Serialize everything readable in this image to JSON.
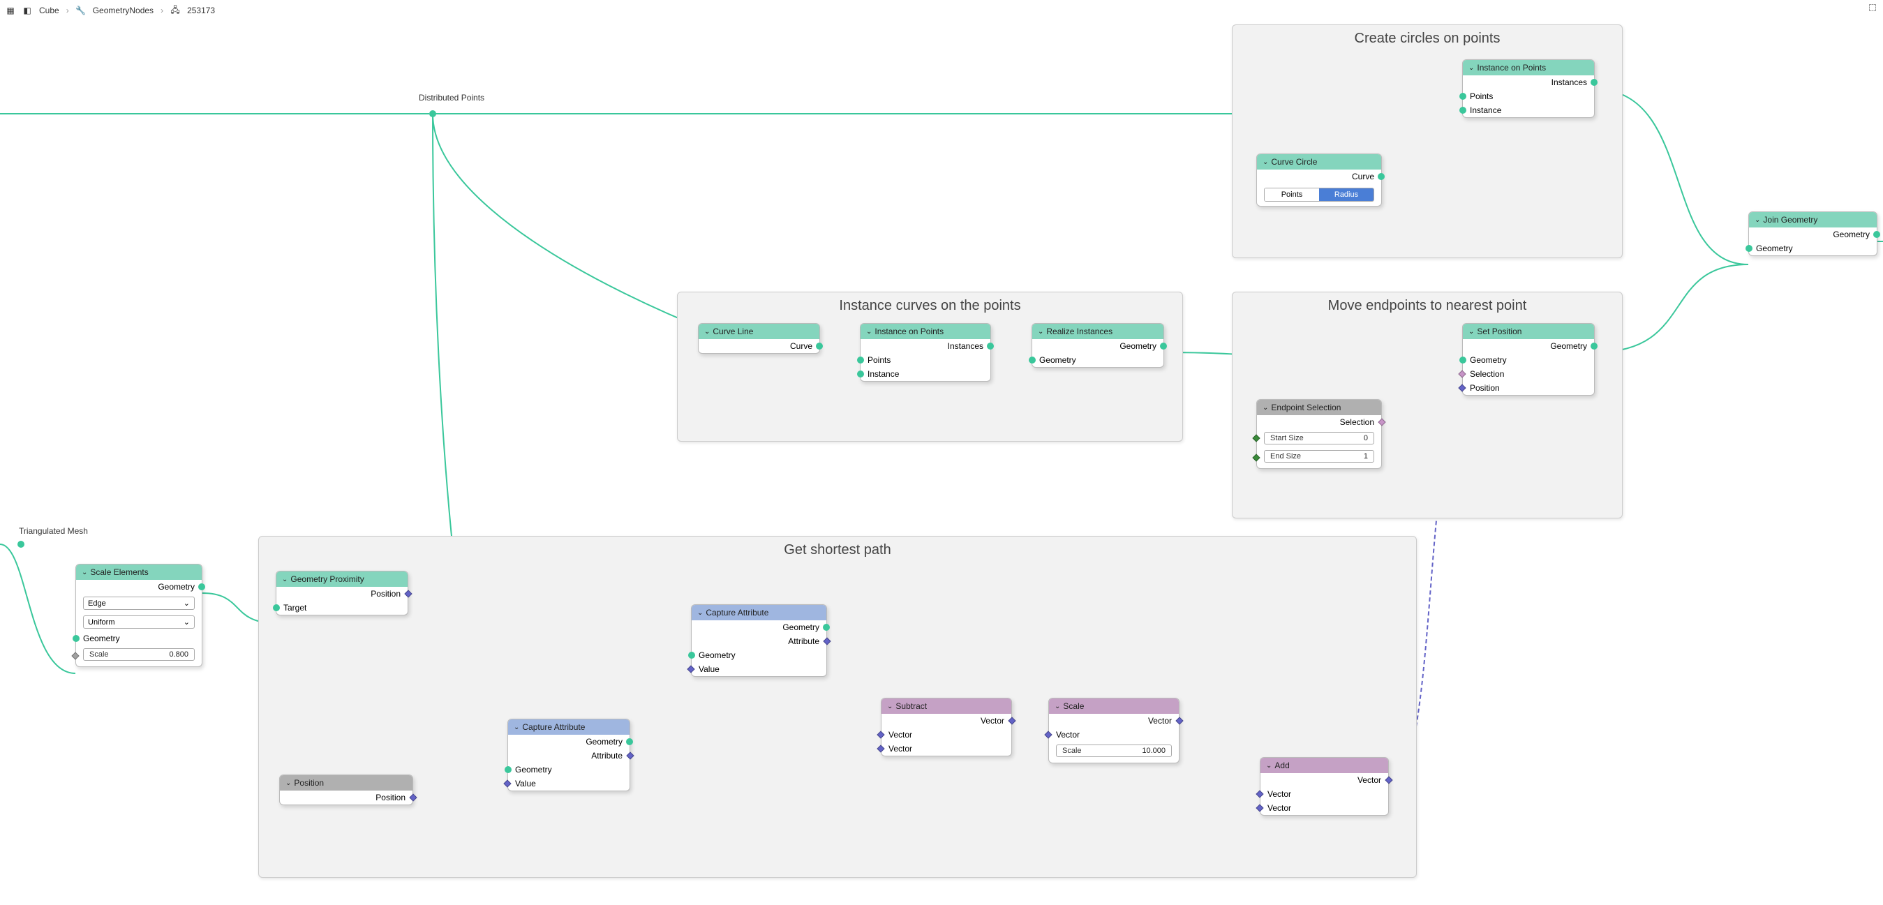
{
  "breadcrumb": {
    "cube": "Cube",
    "gn": "GeometryNodes",
    "num": "253173"
  },
  "labels": {
    "distributed_points": "Distributed Points",
    "triangulated_mesh": "Triangulated Mesh"
  },
  "frames": {
    "circles": "Create circles on points",
    "instance_curves": "Instance curves on the points",
    "move_endpoints": "Move endpoints to nearest point",
    "shortest_path": "Get shortest path"
  },
  "nodes": {
    "instance_on_points1": {
      "title": "Instance on Points",
      "out_instances": "Instances",
      "in_points": "Points",
      "in_instance": "Instance"
    },
    "curve_circle": {
      "title": "Curve Circle",
      "out_curve": "Curve",
      "tab_points": "Points",
      "tab_radius": "Radius"
    },
    "join_geometry": {
      "title": "Join Geometry",
      "out_geometry": "Geometry",
      "in_geometry": "Geometry"
    },
    "curve_line": {
      "title": "Curve Line",
      "out_curve": "Curve"
    },
    "instance_on_points2": {
      "title": "Instance on Points",
      "out_instances": "Instances",
      "in_points": "Points",
      "in_instance": "Instance"
    },
    "realize_instances": {
      "title": "Realize Instances",
      "out_geometry": "Geometry",
      "in_geometry": "Geometry"
    },
    "set_position": {
      "title": "Set Position",
      "out_geometry": "Geometry",
      "in_geometry": "Geometry",
      "in_selection": "Selection",
      "in_position": "Position"
    },
    "endpoint_selection": {
      "title": "Endpoint Selection",
      "out_selection": "Selection",
      "start_size_label": "Start Size",
      "start_size_val": "0",
      "end_size_label": "End Size",
      "end_size_val": "1"
    },
    "scale_elements": {
      "title": "Scale Elements",
      "out_geometry": "Geometry",
      "drop_edge": "Edge",
      "drop_uniform": "Uniform",
      "in_geometry": "Geometry",
      "scale_label": "Scale",
      "scale_val": "0.800"
    },
    "geometry_proximity": {
      "title": "Geometry Proximity",
      "out_position": "Position",
      "in_target": "Target"
    },
    "position": {
      "title": "Position",
      "out_position": "Position"
    },
    "capture_attribute1": {
      "title": "Capture Attribute",
      "out_geometry": "Geometry",
      "out_attribute": "Attribute",
      "in_geometry": "Geometry",
      "in_value": "Value"
    },
    "capture_attribute2": {
      "title": "Capture Attribute",
      "out_geometry": "Geometry",
      "out_attribute": "Attribute",
      "in_geometry": "Geometry",
      "in_value": "Value"
    },
    "subtract": {
      "title": "Subtract",
      "out_vector": "Vector",
      "in_vector1": "Vector",
      "in_vector2": "Vector"
    },
    "scale_vec": {
      "title": "Scale",
      "out_vector": "Vector",
      "in_vector": "Vector",
      "scale_label": "Scale",
      "scale_val": "10.000"
    },
    "add": {
      "title": "Add",
      "out_vector": "Vector",
      "in_vector1": "Vector",
      "in_vector2": "Vector"
    }
  }
}
